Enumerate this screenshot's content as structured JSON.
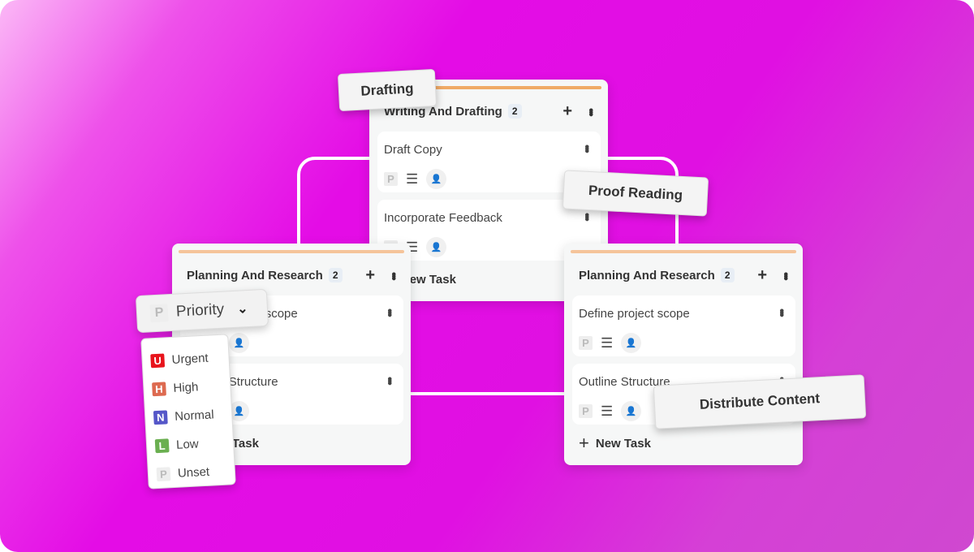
{
  "columns": [
    {
      "title": "Planning And Research",
      "count": "2",
      "tasks": [
        {
          "title": "Define project scope"
        },
        {
          "title": "Outline Structure"
        }
      ],
      "new_task": "New Task"
    },
    {
      "title": "Writing And Drafting",
      "count": "2",
      "tasks": [
        {
          "title": "Draft Copy"
        },
        {
          "title": "Incorporate Feedback"
        }
      ],
      "new_task": "New Task"
    },
    {
      "title": "Planning And Research",
      "count": "2",
      "tasks": [
        {
          "title": "Define project scope"
        },
        {
          "title": "Outline Structure"
        }
      ],
      "new_task": "New Task"
    }
  ],
  "tags": {
    "drafting": "Drafting",
    "proof": "Proof Reading",
    "distribute": "Distribute Content"
  },
  "priority": {
    "label": "Priority",
    "letter": "P",
    "options": [
      {
        "letter": "U",
        "label": "Urgent",
        "color": "#e8141c"
      },
      {
        "letter": "H",
        "label": "High",
        "color": "#dd6a50"
      },
      {
        "letter": "N",
        "label": "Normal",
        "color": "#5557c8"
      },
      {
        "letter": "L",
        "label": "Low",
        "color": "#6aaf50"
      },
      {
        "letter": "P",
        "label": "Unset",
        "color": "#eeeeee"
      }
    ]
  },
  "icons": {
    "priority": "P"
  }
}
